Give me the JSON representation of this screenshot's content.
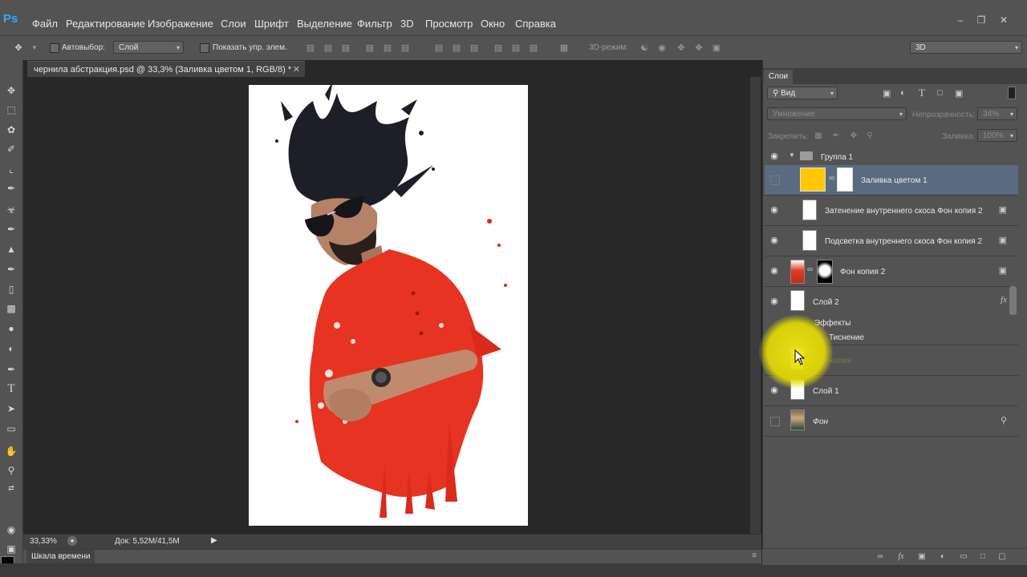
{
  "app": {
    "logo": "Ps"
  },
  "menu": [
    "Файл",
    "Редактирование",
    "Изображение",
    "Слои",
    "Шрифт",
    "Выделение",
    "Фильтр",
    "3D",
    "Просмотр",
    "Окно",
    "Справка"
  ],
  "window_controls": [
    "minimize-icon",
    "restore-icon",
    "close-icon"
  ],
  "options": {
    "autoselect_label": "Автовыбор:",
    "autoselect_value": "Слой",
    "show_transform_label": "Показать упр. элем.",
    "mode_3d_label": "3D-режим:",
    "workspace_value": "3D"
  },
  "document": {
    "tab_title": "чернила абстракция.psd @ 33,3% (Заливка цветом 1, RGB/8) *",
    "zoom": "33,33%",
    "doc_info": "Док: 5,52M/41,5M"
  },
  "timeline": {
    "label": "Шкала времени"
  },
  "layers_panel": {
    "tab": "Слои",
    "filter_value": "Вид",
    "blend_mode": "Умножение",
    "opacity_label": "Непрозрачность:",
    "opacity_value": "34%",
    "lock_label": "Закрепить:",
    "fill_label": "Заливка:",
    "fill_value": "100%",
    "layers": [
      {
        "name": "Группа 1"
      },
      {
        "name": "Заливка цветом 1"
      },
      {
        "name": "Затенение внутреннего скоса Фон копия 2"
      },
      {
        "name": "Подсветка внутреннего скоса Фон копия 2"
      },
      {
        "name": "Фон копия 2"
      },
      {
        "name": "Слой 2",
        "fx": "fx"
      },
      {
        "name": "Эффекты"
      },
      {
        "name": "Тиснение"
      },
      {
        "name": "Фон копия"
      },
      {
        "name": "Слой 1"
      },
      {
        "name": "Фон"
      }
    ]
  },
  "colors": {
    "fill_swatch": "#ffc800",
    "selected_layer_bg": "#5a6a80",
    "accent_ps": "#31a8ff"
  }
}
